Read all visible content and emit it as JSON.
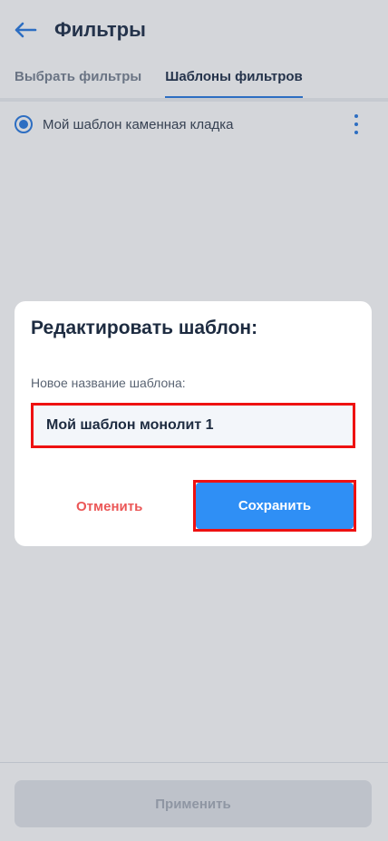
{
  "header": {
    "back_icon": "arrow-left-icon",
    "title": "Фильтры"
  },
  "tabs": [
    {
      "label": "Выбрать фильтры",
      "active": false
    },
    {
      "label": "Шаблоны фильтров",
      "active": true
    }
  ],
  "templates": [
    {
      "label": "Мой шаблон каменная кладка",
      "selected": true,
      "menu_icon": "more-vertical-icon"
    }
  ],
  "bottom": {
    "apply_label": "Применить"
  },
  "dialog": {
    "title": "Редактировать шаблон:",
    "field_label": "Новое название шаблона:",
    "field_value": "Мой шаблон монолит 1",
    "cancel_label": "Отменить",
    "save_label": "Сохранить"
  },
  "colors": {
    "accent": "#2f7de1",
    "save_button": "#2f8ff5",
    "cancel_text": "#eb5757",
    "highlight": "#ee1111"
  }
}
